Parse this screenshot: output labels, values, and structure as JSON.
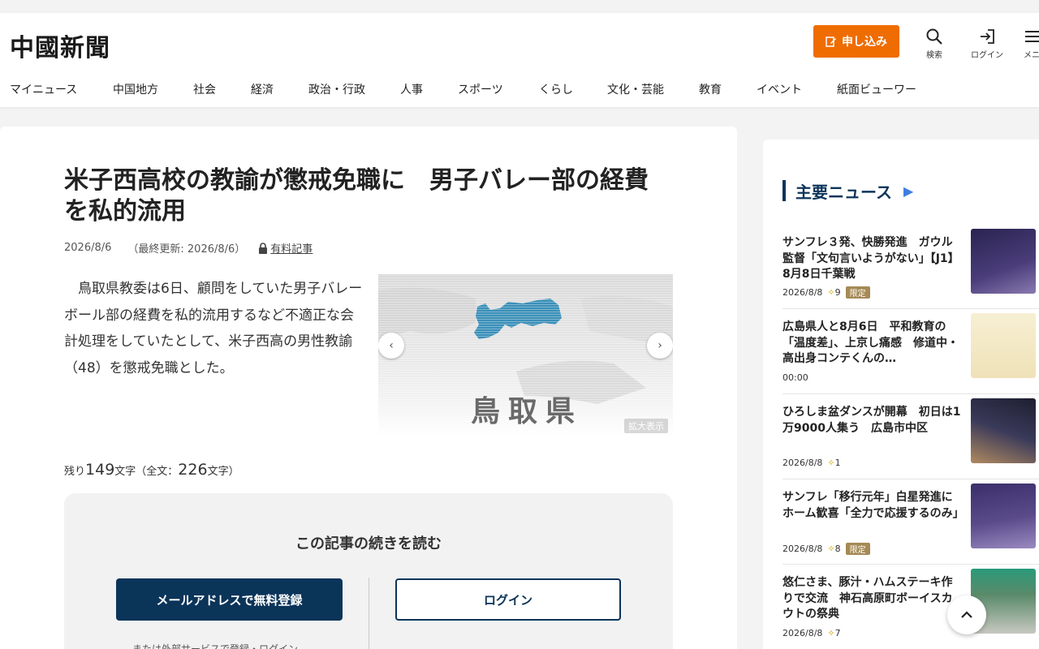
{
  "header": {
    "logo": "中國新聞",
    "apply_label": "申し込み",
    "search_label": "検索",
    "login_label": "ログイン",
    "menu_label": "メニ"
  },
  "nav": [
    "マイニュース",
    "中国地方",
    "社会",
    "経済",
    "政治・行政",
    "人事",
    "スポーツ",
    "くらし",
    "文化・芸能",
    "教育",
    "イベント",
    "紙面ビューワー"
  ],
  "article": {
    "title": "米子西高校の教諭が懲戒免職に　男子バレー部の経費を私的流用",
    "date": "2026/8/6",
    "updated": "（最終更新: 2026/8/6）",
    "paid_label": "有料記事",
    "lead": "　鳥取県教委は6日、顧問をしていた男子バレーボール部の経費を私的流用するなど不適正な会計処理をしていたとして、米子西高の男性教諭（48）を懲戒免職とした。",
    "photo_caption": "鳥取県",
    "zoom_label": "拡大表示",
    "remaining_prefix": "残り",
    "remaining_count": "149",
    "remaining_mid": "文字（全文：",
    "total_count": "226",
    "remaining_suffix": "文字）"
  },
  "paywall": {
    "heading": "この記事の続きを読む",
    "register_button": "メールアドレスで無料登録",
    "login_button": "ログイン",
    "external_note": "または外部サービスで登録・ログイン"
  },
  "sidebar": {
    "heading": "主要ニュース",
    "items": [
      {
        "text": "サンフレ３発、快勝発進　ガウル監督「文句言いようがない」【J1】8月8日千葉戦",
        "date": "2026/8/8",
        "stars": "9",
        "tag": "限定",
        "thumb_color": "#4a3d7a"
      },
      {
        "text": "広島県人と8月6日　平和教育の「温度差」、上京し痛感　修道中・高出身コンテくんの…",
        "date": "00:00",
        "stars": "",
        "tag": "",
        "thumb_color": "#f3e9c9"
      },
      {
        "text": "ひろしま盆ダンスが開幕　初日は1万9000人集う　広島市中区",
        "date": "2026/8/8",
        "stars": "1",
        "tag": "",
        "thumb_color": "#3a3a5a"
      },
      {
        "text": "サンフレ「移行元年」白星発進にホーム歓喜「全力で応援するのみ」",
        "date": "2026/8/8",
        "stars": "8",
        "tag": "限定",
        "thumb_color": "#5a4a8a"
      },
      {
        "text": "悠仁さま、豚汁・ハムステーキ作りで交流　神石高原町ボーイスカウトの祭典",
        "date": "2026/8/8",
        "stars": "7",
        "tag": "",
        "thumb_color": "#5a8a6a"
      }
    ]
  },
  "colors": {
    "accent": "#ef6c00",
    "navy": "#0b3459",
    "map_blue": "#3a8fb8"
  }
}
